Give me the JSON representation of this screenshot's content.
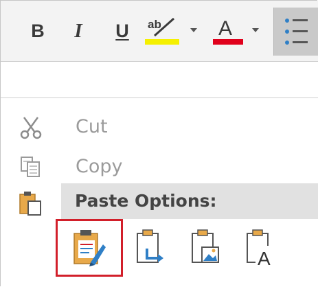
{
  "toolbar": {
    "bold_label": "B",
    "italic_label": "I",
    "underline_label": "U",
    "highlight_icon": "text-highlight-color-icon",
    "highlight_color": "#f5f000",
    "font_color_icon": "font-color-icon",
    "font_color": "#e0001b",
    "font_color_letter": "A",
    "highlight_letters": "ab",
    "bullets_icon": "bullets-icon"
  },
  "menu": {
    "items": [
      {
        "label": "Cut",
        "icon": "scissors-icon",
        "enabled": false
      },
      {
        "label": "Copy",
        "icon": "copy-icon",
        "enabled": false
      }
    ],
    "paste_header": "Paste Options:",
    "paste_icon": "clipboard-icon",
    "paste_options": [
      {
        "icon": "keep-source-formatting-icon",
        "selected": true
      },
      {
        "icon": "merge-formatting-icon",
        "selected": false
      },
      {
        "icon": "picture-paste-icon",
        "selected": false
      },
      {
        "icon": "keep-text-only-icon",
        "selected": false
      }
    ],
    "text_only_letter": "A"
  },
  "colors": {
    "toolbar_bg": "#f3f3f3",
    "selected_border": "#d21f2a",
    "clipboard_orange": "#e8a94a",
    "accent_blue": "#2f7fc6"
  }
}
